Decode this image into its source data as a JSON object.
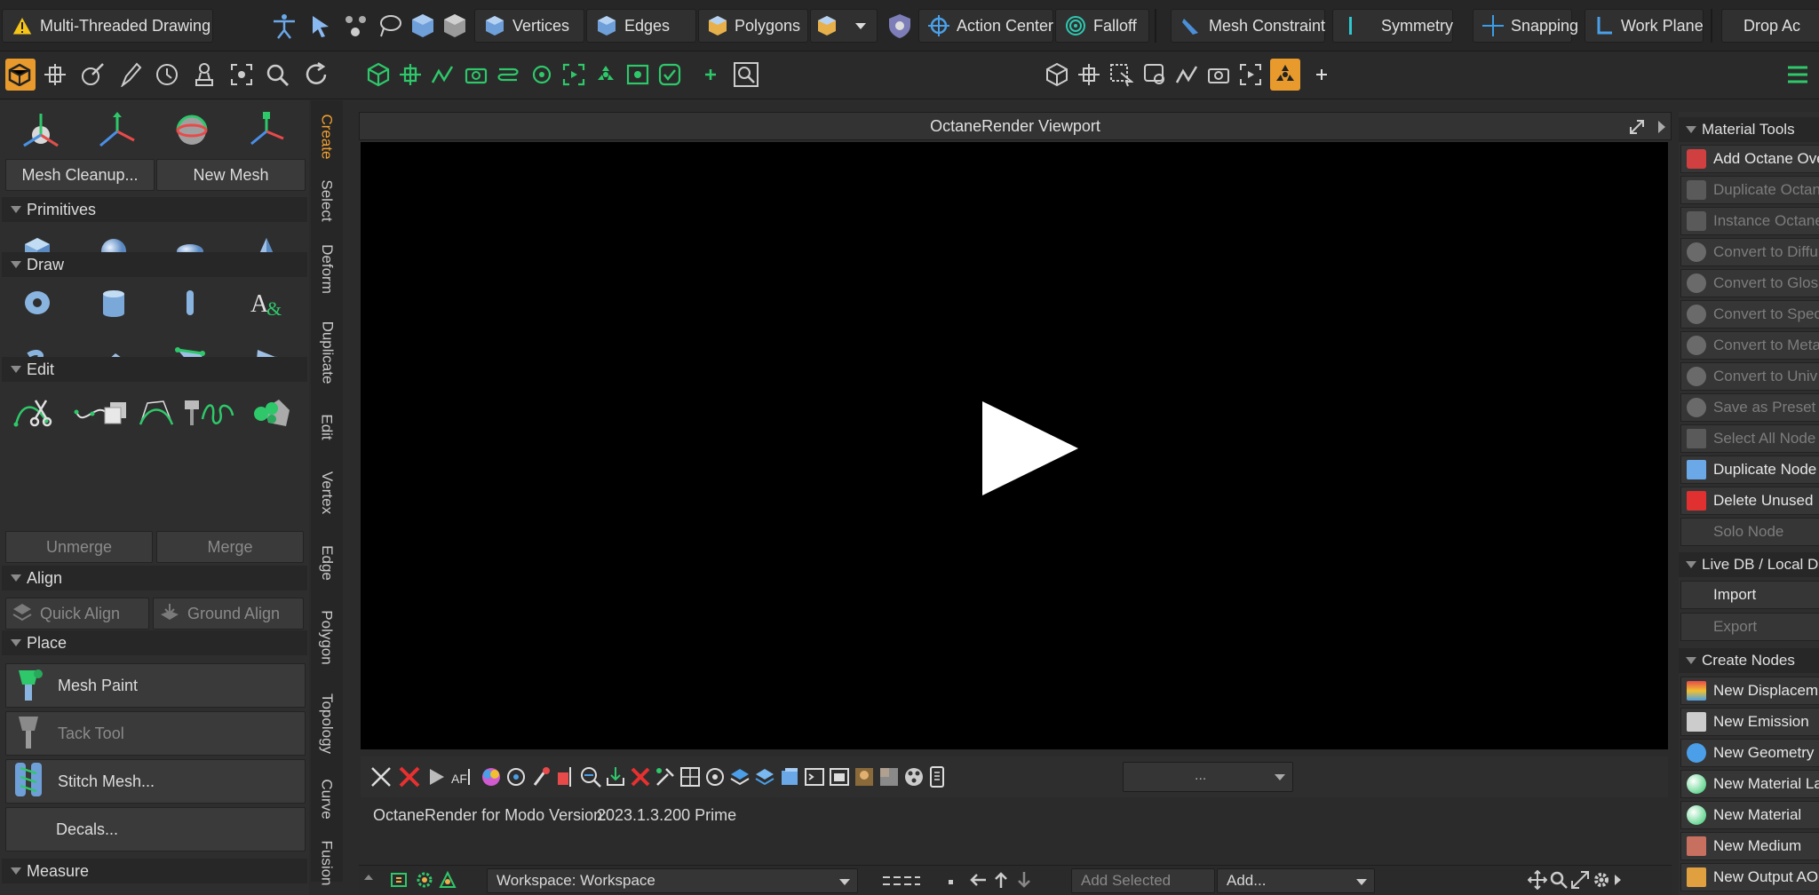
{
  "top_toolbar": {
    "mode_label": "Multi-Threaded Drawing",
    "vertices": "Vertices",
    "edges": "Edges",
    "polygons": "Polygons",
    "action_center": "Action Center",
    "falloff": "Falloff",
    "mesh_constraint": "Mesh Constraint",
    "symmetry": "Symmetry",
    "snapping": "Snapping",
    "work_plane": "Work Plane",
    "drop_action": "Drop Ac"
  },
  "left_panel": {
    "vertical_tabs": [
      "Create",
      "Select",
      "Deform",
      "Duplicate",
      "Edit",
      "Vertex",
      "Edge",
      "Polygon",
      "Topology",
      "Curve",
      "Fusion"
    ],
    "mesh_cleanup": "Mesh Cleanup...",
    "new_mesh": "New Mesh",
    "primitives": "Primitives",
    "draw": "Draw",
    "edit": "Edit",
    "unmerge": "Unmerge",
    "merge": "Merge",
    "align": "Align",
    "quick_align": "Quick Align",
    "ground_align": "Ground Align",
    "place": "Place",
    "mesh_paint": "Mesh Paint",
    "tack_tool": "Tack Tool",
    "stitch_mesh": "Stitch Mesh...",
    "decals": "Decals...",
    "measure": "Measure"
  },
  "viewport": {
    "title": "OctaneRender Viewport",
    "dropdown_value": "...",
    "version_label": "OctaneRender for Modo Version:",
    "version_value": "2023.1.3.200 Prime"
  },
  "bottom_bar": {
    "workspace": "Workspace: Workspace",
    "add_selected": "Add Selected",
    "add": "Add..."
  },
  "right_panel": {
    "material_tools": "Material Tools",
    "items": [
      {
        "label": "Add Octane Ove",
        "enabled": true
      },
      {
        "label": "Duplicate Octan",
        "enabled": false
      },
      {
        "label": "Instance Octane",
        "enabled": false
      },
      {
        "label": "Convert to Diffu",
        "enabled": false
      },
      {
        "label": "Convert to Glos",
        "enabled": false
      },
      {
        "label": "Convert to Spec",
        "enabled": false
      },
      {
        "label": "Convert to Meta",
        "enabled": false
      },
      {
        "label": "Convert to Univ",
        "enabled": false
      },
      {
        "label": "Save as Preset",
        "enabled": false
      },
      {
        "label": "Select All Node",
        "enabled": false
      },
      {
        "label": "Duplicate Node",
        "enabled": true
      },
      {
        "label": "Delete Unused",
        "enabled": true
      },
      {
        "label": "Solo Node",
        "enabled": false
      }
    ],
    "live_db": "Live DB / Local D",
    "import": "Import",
    "export": "Export",
    "create_nodes": "Create Nodes",
    "create_items": [
      "New Displacem",
      "New Emission",
      "New Geometry",
      "New Material La",
      "New Material",
      "New Medium",
      "New Output AO"
    ]
  },
  "colors": {
    "accent_orange": "#f0a030",
    "tool_green": "#2ec86a",
    "tool_blue": "#3a8fd8"
  }
}
